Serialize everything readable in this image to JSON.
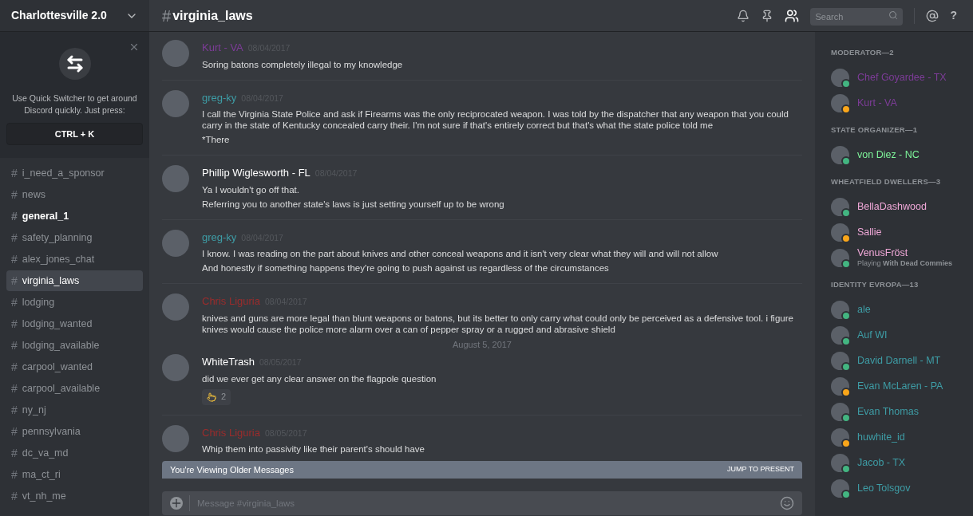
{
  "server": {
    "name": "Charlottesville 2.0"
  },
  "quick_switcher": {
    "text": "Use Quick Switcher to get around Discord quickly. Just press:",
    "shortcut": "CTRL + K"
  },
  "channels": [
    {
      "name": "i_need_a_sponsor",
      "unread": false,
      "selected": false
    },
    {
      "name": "news",
      "unread": false,
      "selected": false
    },
    {
      "name": "general_1",
      "unread": true,
      "selected": false
    },
    {
      "name": "safety_planning",
      "unread": false,
      "selected": false
    },
    {
      "name": "alex_jones_chat",
      "unread": false,
      "selected": false
    },
    {
      "name": "virginia_laws",
      "unread": false,
      "selected": true
    },
    {
      "name": "lodging",
      "unread": false,
      "selected": false
    },
    {
      "name": "lodging_wanted",
      "unread": false,
      "selected": false
    },
    {
      "name": "lodging_available",
      "unread": false,
      "selected": false
    },
    {
      "name": "carpool_wanted",
      "unread": false,
      "selected": false
    },
    {
      "name": "carpool_available",
      "unread": false,
      "selected": false
    },
    {
      "name": "ny_nj",
      "unread": false,
      "selected": false
    },
    {
      "name": "pennsylvania",
      "unread": false,
      "selected": false
    },
    {
      "name": "dc_va_md",
      "unread": false,
      "selected": false
    },
    {
      "name": "ma_ct_ri",
      "unread": false,
      "selected": false
    },
    {
      "name": "vt_nh_me",
      "unread": false,
      "selected": false
    }
  ],
  "header": {
    "hash": "#",
    "channel": "virginia_laws",
    "search_placeholder": "Search",
    "help": "?"
  },
  "messages": [
    {
      "kind": "message",
      "author": "Kurt - VA",
      "color": "#7d3c98",
      "date": "08/04/2017",
      "lines": [
        "Soring batons completely illegal to my knowledge"
      ]
    },
    {
      "kind": "message",
      "author": "greg-ky",
      "color": "#3e9da6",
      "date": "08/04/2017",
      "lines": [
        "I call the Virginia State Police and ask if Firearms was the only reciprocated weapon. I was told by the dispatcher that any weapon that you could carry in the state of Kentucky concealed carry their. I'm not sure if that's entirely correct but that's what the state police told me",
        "*There"
      ]
    },
    {
      "kind": "message",
      "author": "Phillip Wiglesworth - FL",
      "color": "#ffffff",
      "date": "08/04/2017",
      "lines": [
        "Ya I wouldn't go off that.",
        "Referring you to another state's laws is just setting yourself up to be wrong"
      ]
    },
    {
      "kind": "message",
      "author": "greg-ky",
      "color": "#3e9da6",
      "date": "08/04/2017",
      "lines": [
        "I know. I was reading on the part about knives and other conceal weapons and it isn't very clear what they will and will not allow",
        "And honestly if something happens they're going to push against us regardless of the circumstances"
      ]
    },
    {
      "kind": "message",
      "author": "Chris Liguria",
      "color": "#9b2c2c",
      "date": "08/04/2017",
      "lines": [
        "knives and guns are more legal than blunt weapons or batons, but its better to only carry what could only be perceived as a defensive tool. i figure knives would cause the police more alarm over a can of pepper spray or a rugged and abrasive shield"
      ]
    },
    {
      "kind": "divider",
      "text": "August 5, 2017"
    },
    {
      "kind": "message",
      "author": "WhiteTrash",
      "color": "#ffffff",
      "date": "08/05/2017",
      "lines": [
        "did we ever get any clear answer on the flagpole question"
      ],
      "reaction": {
        "count": "2"
      }
    },
    {
      "kind": "message",
      "author": "Chris Liguria",
      "color": "#9b2c2c",
      "date": "08/05/2017",
      "lines": [
        "Whip them into passivity like their parent's should have"
      ]
    }
  ],
  "older_banner": {
    "text": "You're Viewing Older Messages",
    "action": "JUMP TO PRESENT"
  },
  "composer": {
    "placeholder": "Message #virginia_laws"
  },
  "member_groups": [
    {
      "title": "MODERATOR—2",
      "members": [
        {
          "name": "Chef Goyardee - TX",
          "color": "#7d3c98",
          "idle": false
        },
        {
          "name": "Kurt - VA",
          "color": "#7d3c98",
          "idle": true
        }
      ]
    },
    {
      "title": "STATE ORGANIZER—1",
      "members": [
        {
          "name": "von Diez - NC",
          "color": "#7ef49a",
          "idle": false
        }
      ]
    },
    {
      "title": "WHEATFIELD DWELLERS—3",
      "members": [
        {
          "name": "BellaDashwood",
          "color": "#f0a8d8",
          "idle": false
        },
        {
          "name": "Sallie",
          "color": "#f0a8d8",
          "idle": true
        },
        {
          "name": "VenusFröst",
          "color": "#f0a8d8",
          "idle": false,
          "activity": "Playing **With Dead Commies**"
        }
      ]
    },
    {
      "title": "IDENTITY EVROPA—13",
      "members": [
        {
          "name": "ale",
          "color": "#3e9da6",
          "idle": false
        },
        {
          "name": "Auf WI",
          "color": "#3e9da6",
          "idle": false
        },
        {
          "name": "David Darnell - MT",
          "color": "#3e9da6",
          "idle": false
        },
        {
          "name": "Evan McLaren - PA",
          "color": "#3e9da6",
          "idle": true
        },
        {
          "name": "Evan Thomas",
          "color": "#3e9da6",
          "idle": false
        },
        {
          "name": "huwhite_id",
          "color": "#3e9da6",
          "idle": true
        },
        {
          "name": "Jacob - TX",
          "color": "#3e9da6",
          "idle": false
        },
        {
          "name": "Leo Tolsgov",
          "color": "#3e9da6",
          "idle": false
        }
      ]
    }
  ]
}
